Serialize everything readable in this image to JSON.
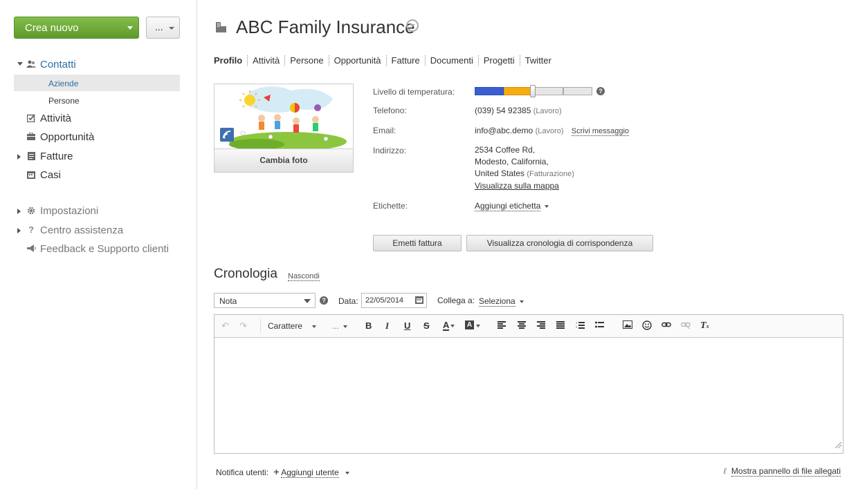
{
  "sidebar": {
    "create_label": "Crea nuovo",
    "more_label": "...",
    "items": [
      {
        "label": "Contatti",
        "icon": "people-icon",
        "expanded": true
      },
      {
        "label": "Attività",
        "icon": "checkbox-icon"
      },
      {
        "label": "Opportunità",
        "icon": "briefcase-icon"
      },
      {
        "label": "Fatture",
        "icon": "invoice-icon"
      },
      {
        "label": "Casi",
        "icon": "calendar-icon"
      }
    ],
    "subitems": [
      {
        "label": "Aziende",
        "active": true
      },
      {
        "label": "Persone"
      }
    ],
    "bottom_items": [
      {
        "label": "Impostazioni",
        "icon": "gear-icon"
      },
      {
        "label": "Centro assistenza",
        "icon": "question-icon"
      },
      {
        "label": "Feedback e Supporto clienti",
        "icon": "megaphone-icon"
      }
    ]
  },
  "header": {
    "title": "ABC Family Insurance"
  },
  "tabs": [
    "Profilo",
    "Attività",
    "Persone",
    "Opportunità",
    "Fatture",
    "Documenti",
    "Progetti",
    "Twitter"
  ],
  "photo": {
    "change_label": "Cambia foto"
  },
  "profile": {
    "temp_label": "Livello di temperatura:",
    "temperature_level": 0.5,
    "phone_label": "Telefono:",
    "phone": "(039) 54 92385",
    "phone_type": "(Lavoro)",
    "email_label": "Email:",
    "email": "info@abc.demo",
    "email_type": "(Lavoro)",
    "write_msg": "Scrivi messaggio",
    "address_label": "Indirizzo:",
    "address_line1": "2534 Coffee Rd,",
    "address_line2": "Modesto, California,",
    "address_line3": "United States",
    "address_type": "(Fatturazione)",
    "map_link": "Visualizza sulla mappa",
    "tags_label": "Etichette:",
    "add_tag": "Aggiungi etichetta"
  },
  "actions": {
    "invoice": "Emetti fattura",
    "history": "Visualizza cronologia di corrispondenza"
  },
  "history": {
    "title": "Cronologia",
    "hide": "Nascondi",
    "type_value": "Nota",
    "date_label": "Data:",
    "date_value": "22/05/2014",
    "link_label": "Collega a:",
    "link_value": "Seleziona",
    "font_label": "Carattere",
    "size_label": "..."
  },
  "footer": {
    "notify_label": "Notifica utenti:",
    "add_user": "Aggiungi utente",
    "attachments": "Mostra pannello di file allegati"
  },
  "colors": {
    "green": "#6aa834",
    "temp_blue": "#3a5fd0",
    "temp_orange": "#f5ad12"
  }
}
